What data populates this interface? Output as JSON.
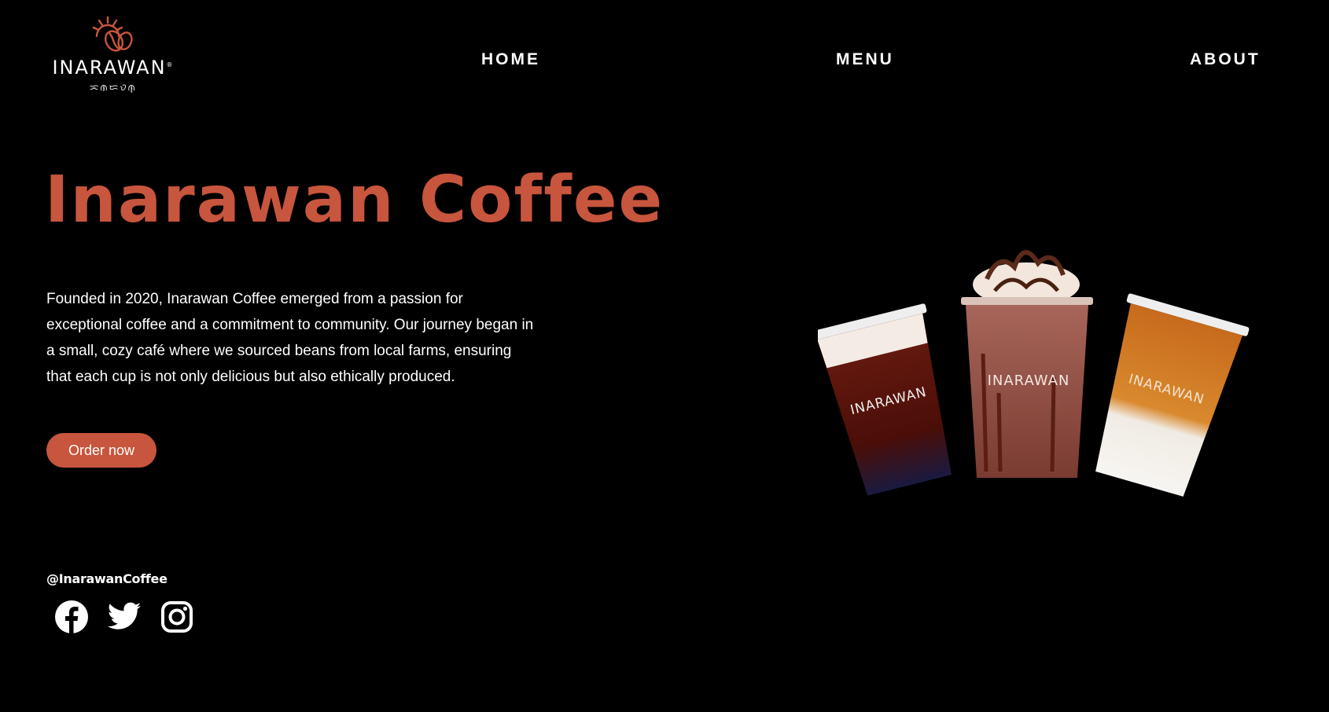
{
  "brand": {
    "name": "INARAWAN",
    "registered_mark": "®",
    "subtitle": "ᜁᜈᜇᜏᜈ᜔"
  },
  "nav": {
    "items": [
      {
        "label": "HOME"
      },
      {
        "label": "MENU"
      },
      {
        "label": "ABOUT"
      }
    ]
  },
  "hero": {
    "title": "Inarawan Coffee",
    "description": "Founded in 2020, Inarawan Coffee emerged from a passion for exceptional coffee and a commitment to community. Our journey began in a small, cozy café where we sourced beans from local farms, ensuring that each cup is not only delicious but also ethically produced.",
    "cta_label": "Order now"
  },
  "social": {
    "handle": "@InarawanCoffee",
    "icons": [
      "facebook-icon",
      "twitter-icon",
      "instagram-icon"
    ]
  },
  "product_image": {
    "cup_brand_text": "INARAWAN",
    "cups": [
      "cold brew",
      "frappe",
      "iced latte"
    ]
  },
  "colors": {
    "background": "#000000",
    "accent": "#c8553d",
    "text": "#ffffff"
  }
}
